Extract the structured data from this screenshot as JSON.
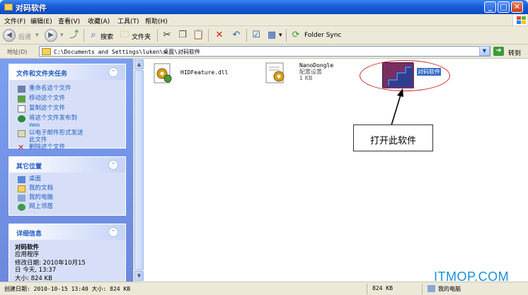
{
  "window": {
    "title": "对码软件",
    "buttons": {
      "minimize": "_",
      "maximize": "□",
      "close": "✕"
    }
  },
  "menu": [
    "文件(F)",
    "编辑(E)",
    "查看(V)",
    "收藏(A)",
    "工具(T)",
    "帮助(H)"
  ],
  "toolbar": {
    "back_label": "后退",
    "search_label": "搜索",
    "folders_label": "文件夹",
    "folder_sync_label": "Folder Sync"
  },
  "address": {
    "label": "地址(D)",
    "value": "C:\\Documents and Settings\\luken\\桌面\\对码软件",
    "go_label": "转到"
  },
  "left_panels": {
    "file_tasks": {
      "title": "文件和文件夹任务",
      "items": [
        "重命名这个文件",
        "移动这个文件",
        "复制这个文件",
        "将这个文件发布到",
        "Web",
        "以电子邮件形式发送",
        "此文件",
        "删除这个文件"
      ]
    },
    "other_places": {
      "title": "其它位置",
      "items": [
        "桌面",
        "我的文档",
        "我的电脑",
        "网上邻居"
      ]
    },
    "details": {
      "title": "详细信息",
      "name": "对码软件",
      "type": "应用程序",
      "modified_line1": "修改日期: 2010年10月15",
      "modified_line2": "日 今天, 13:37",
      "size": "大小: 824 KB"
    }
  },
  "files": [
    {
      "name": "HIDFeature.dll"
    },
    {
      "name": "NanoDongle",
      "type": "配置设置",
      "size": "1 KB"
    },
    {
      "name": "对码软件"
    }
  ],
  "annotation": {
    "callout": "打开此软件"
  },
  "watermark": "ITMOP.COM",
  "status": {
    "details": "创建日期: 2010-10-15 13:40 大小: 824 KB",
    "size": "824 KB",
    "location": "我的电脑"
  },
  "colors": {
    "titlebar": "#0a4bc4",
    "task_link": "#215dc6",
    "selection": "#316ac5",
    "annotation_red": "#d12a2a",
    "watermark": "#1a8fd8"
  },
  "icons": [
    "folder-icon",
    "back-icon",
    "forward-icon",
    "up-folder-icon",
    "search-icon",
    "folders-icon",
    "cut-icon",
    "copy-icon",
    "paste-icon",
    "delete-icon",
    "undo-icon",
    "properties-icon",
    "views-icon",
    "sync-icon"
  ]
}
